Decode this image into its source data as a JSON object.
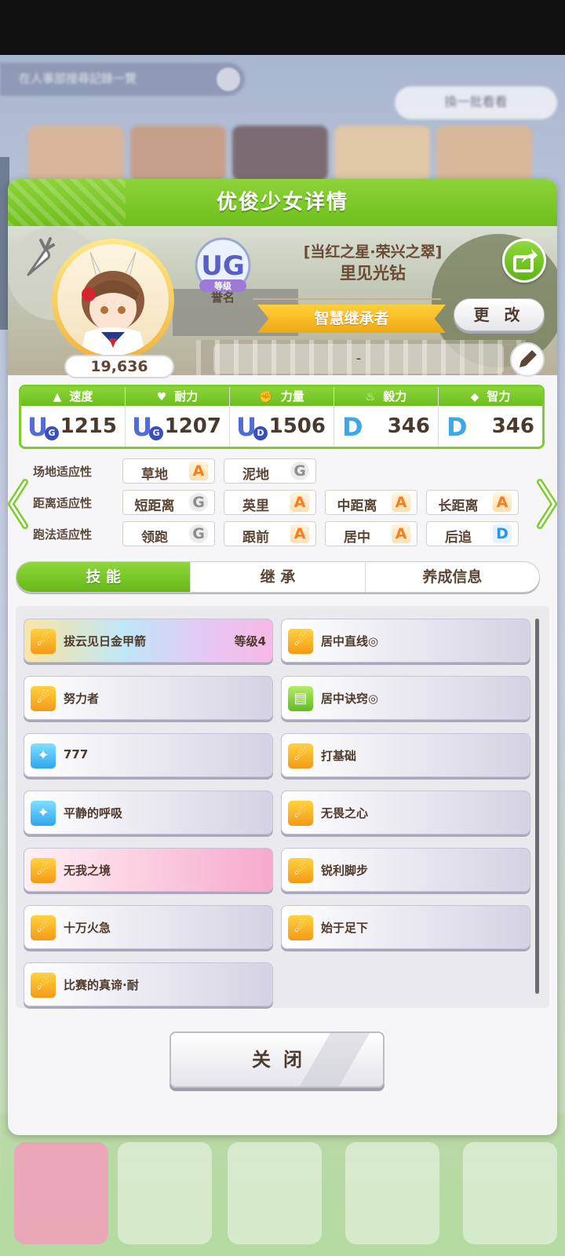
{
  "background": {
    "search_text": "在人事部搜尋記錄一覽",
    "side_button_label": "換一批看看"
  },
  "dialog": {
    "title": "优俊少女详情",
    "fans": "19,636",
    "rank": {
      "badge": "UG",
      "badge_label": "等级",
      "title": "誉名"
    },
    "character": {
      "title": "[当红之星·荣兴之翠]",
      "name": "里见光钻"
    },
    "inheritor_title": "智慧继承者",
    "change_label": "更 改",
    "comment": "-",
    "stats": [
      {
        "label": "速度",
        "icon": "shoe-icon",
        "grade": "U",
        "grade_sub": "G",
        "value": "1215"
      },
      {
        "label": "耐力",
        "icon": "heart-icon",
        "grade": "U",
        "grade_sub": "G",
        "value": "1207"
      },
      {
        "label": "力量",
        "icon": "muscle-icon",
        "grade": "U",
        "grade_sub": "D",
        "value": "1506"
      },
      {
        "label": "毅力",
        "icon": "flame-icon",
        "grade": "D",
        "grade_sub": "",
        "value": "346"
      },
      {
        "label": "智力",
        "icon": "graduation-cap-icon",
        "grade": "D",
        "grade_sub": "",
        "value": "346"
      }
    ],
    "aptitudes": [
      {
        "label": "场地适应性",
        "items": [
          {
            "name": "草地",
            "grade": "A"
          },
          {
            "name": "泥地",
            "grade": "G"
          }
        ]
      },
      {
        "label": "距离适应性",
        "items": [
          {
            "name": "短距离",
            "grade": "G"
          },
          {
            "name": "英里",
            "grade": "A"
          },
          {
            "name": "中距离",
            "grade": "A"
          },
          {
            "name": "长距离",
            "grade": "A"
          }
        ]
      },
      {
        "label": "跑法适应性",
        "items": [
          {
            "name": "领跑",
            "grade": "G"
          },
          {
            "name": "跟前",
            "grade": "A"
          },
          {
            "name": "居中",
            "grade": "A"
          },
          {
            "name": "后追",
            "grade": "D"
          }
        ]
      }
    ],
    "tabs": [
      "技 能",
      "继 承",
      "养成信息"
    ],
    "skills": [
      {
        "name": "拔云见日金甲箭",
        "level": "等级4",
        "style": "rainbow",
        "icon": "orange"
      },
      {
        "name": "居中直线◎",
        "level": "",
        "style": "normal",
        "icon": "orange"
      },
      {
        "name": "努力者",
        "level": "",
        "style": "normal",
        "icon": "orange"
      },
      {
        "name": "居中诀窍◎",
        "level": "",
        "style": "normal",
        "icon": "green"
      },
      {
        "name": "777",
        "level": "",
        "style": "normal",
        "icon": "blue"
      },
      {
        "name": "打基础",
        "level": "",
        "style": "normal",
        "icon": "orange"
      },
      {
        "name": "平静的呼吸",
        "level": "",
        "style": "normal",
        "icon": "blue"
      },
      {
        "name": "无畏之心",
        "level": "",
        "style": "normal",
        "icon": "orange"
      },
      {
        "name": "无我之境",
        "level": "",
        "style": "pink",
        "icon": "orange"
      },
      {
        "name": "锐利脚步",
        "level": "",
        "style": "normal",
        "icon": "orange"
      },
      {
        "name": "十万火急",
        "level": "",
        "style": "normal",
        "icon": "orange"
      },
      {
        "name": "始于足下",
        "level": "",
        "style": "normal",
        "icon": "orange"
      },
      {
        "name": "比赛的真谛·耐",
        "level": "",
        "style": "normal",
        "icon": "orange"
      }
    ],
    "close_label": "关闭"
  },
  "colors": {
    "accent_green": "#76c423",
    "grade_A": "#ff7a1a",
    "grade_D": "#2a94e6",
    "grade_G": "#8f8f8f"
  }
}
